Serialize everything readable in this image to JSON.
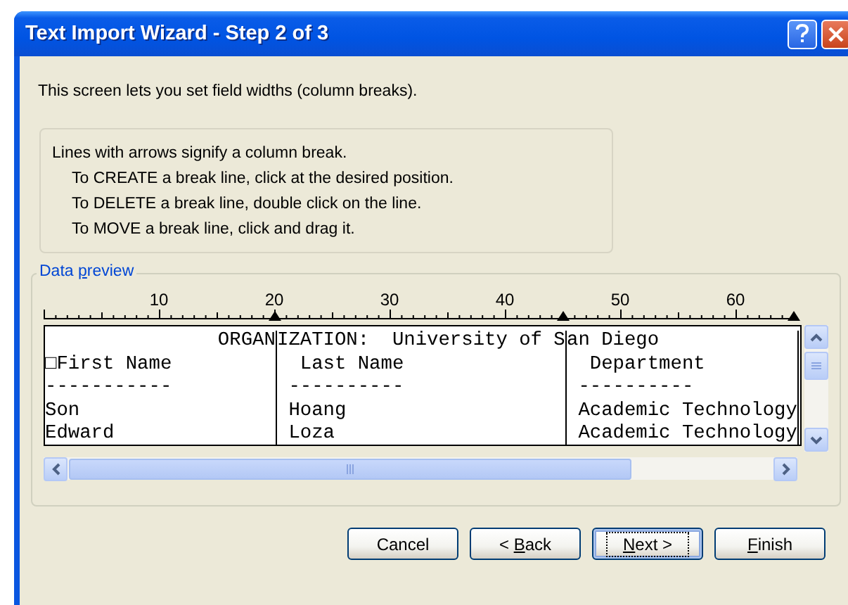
{
  "window": {
    "title": "Text Import Wizard - Step 2 of 3"
  },
  "intro": "This screen lets you set field widths (column breaks).",
  "instructions": {
    "heading": "Lines with arrows signify a column break.",
    "steps": [
      "To CREATE a break line, click at the desired position.",
      "To DELETE a break line, double click on the line.",
      "To MOVE a break line, click and drag it."
    ]
  },
  "data_preview": {
    "legend": [
      {
        "text": "Data ",
        "underline": false
      },
      {
        "text": "p",
        "underline": true
      },
      {
        "text": "review",
        "underline": false
      }
    ],
    "ruler_labels": [
      "10",
      "20",
      "30",
      "40",
      "50",
      "60"
    ],
    "columns": [
      {
        "cells": [
          "               ORGAN",
          "□First Name",
          "-----------",
          "Son",
          "Edward"
        ]
      },
      {
        "cells": [
          "IZATION:  University of S",
          "  Last Name",
          " ----------",
          " Hoang",
          " Loza"
        ]
      },
      {
        "cells": [
          "an Diego",
          "  Department",
          " ----------",
          " Academic Technology",
          " Academic Technology"
        ]
      }
    ]
  },
  "buttons": [
    {
      "focused": false,
      "label": [
        {
          "text": "Cancel",
          "underline": false
        }
      ]
    },
    {
      "focused": false,
      "label": [
        {
          "text": "< ",
          "underline": false
        },
        {
          "text": "B",
          "underline": true
        },
        {
          "text": "ack",
          "underline": false
        }
      ]
    },
    {
      "focused": true,
      "label": [
        {
          "text": "N",
          "underline": true
        },
        {
          "text": "ext >",
          "underline": false
        }
      ]
    },
    {
      "focused": false,
      "label": [
        {
          "text": "F",
          "underline": true
        },
        {
          "text": "inish",
          "underline": false
        }
      ]
    }
  ]
}
